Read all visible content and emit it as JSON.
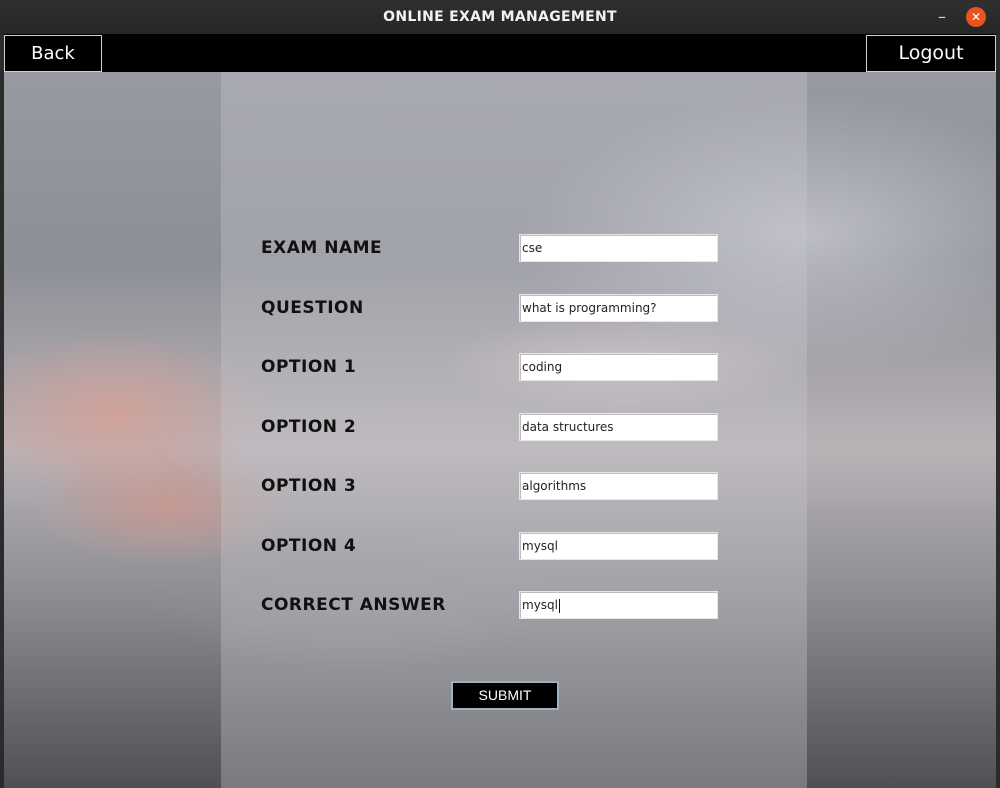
{
  "window": {
    "title": "ONLINE EXAM MANAGEMENT",
    "minimize_glyph": "–",
    "close_glyph": "✕",
    "close_color": "#e95420"
  },
  "topbar": {
    "back_label": "Back",
    "logout_label": "Logout"
  },
  "form": {
    "fields": [
      {
        "label": "EXAM NAME",
        "value": "cse"
      },
      {
        "label": "QUESTION",
        "value": "what is programming?"
      },
      {
        "label": "OPTION 1",
        "value": "coding"
      },
      {
        "label": "OPTION 2",
        "value": "data structures"
      },
      {
        "label": "OPTION 3",
        "value": "algorithms"
      },
      {
        "label": "OPTION 4",
        "value": "mysql"
      },
      {
        "label": "CORRECT ANSWER",
        "value": "mysql"
      }
    ],
    "submit_label": "SUBMIT"
  }
}
